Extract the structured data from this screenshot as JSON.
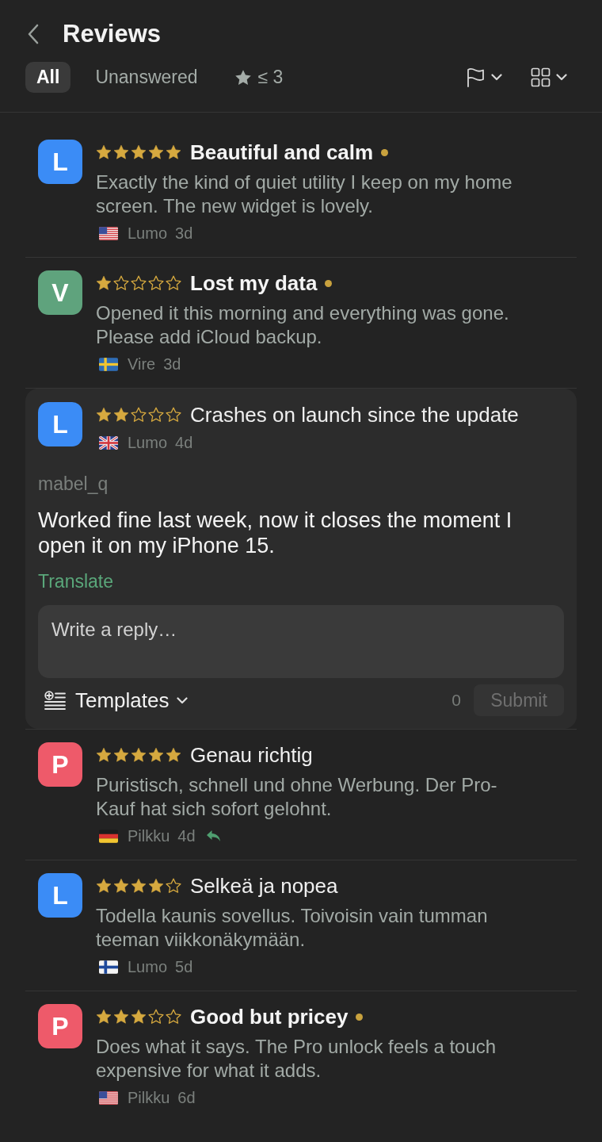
{
  "header": {
    "title": "Reviews"
  },
  "filters": [
    {
      "kind": "text",
      "label": "All",
      "selected": true
    },
    {
      "kind": "text",
      "label": "Unanswered",
      "selected": false
    },
    {
      "kind": "star",
      "label": "≤ 3",
      "selected": false
    }
  ],
  "reviews": [
    {
      "avatar": {
        "letter": "L",
        "color": "#3b8cf6"
      },
      "stars": 5,
      "title": "Beautiful and calm",
      "unread": true,
      "body": "Exactly the kind of quiet utility I keep on my home screen. The new widget is lovely.",
      "flag": {
        "kind": "us"
      },
      "app": "Lumo",
      "age": "3d",
      "replied": false,
      "expanded": false
    },
    {
      "avatar": {
        "letter": "V",
        "color": "#5fa37d"
      },
      "stars": 1,
      "title": "Lost my data",
      "unread": true,
      "body": "Opened it this morning and everything was gone. Please add iCloud backup.",
      "flag": {
        "kind": "se"
      },
      "app": "Vire",
      "age": "3d",
      "replied": false,
      "expanded": false
    },
    {
      "avatar": {
        "letter": "L",
        "color": "#3b8cf6"
      },
      "stars": 2,
      "title": "Crashes on launch since the update",
      "unread": false,
      "flag": {
        "kind": "gb"
      },
      "app": "Lumo",
      "age": "4d",
      "replied": false,
      "expanded": true,
      "author": "mabel_q",
      "body": "Worked fine last week, now it closes the moment I open it on my iPhone 15.",
      "translate": "Translate",
      "reply": {
        "placeholder": "Write a reply…",
        "templates": "Templates",
        "count": "0",
        "submit": "Submit",
        "submit_disabled": true
      }
    },
    {
      "avatar": {
        "letter": "P",
        "color": "#ee5a6a"
      },
      "stars": 5,
      "title": "Genau richtig",
      "unread": false,
      "body": "Puristisch, schnell und ohne Werbung. Der Pro-Kauf hat sich sofort gelohnt.",
      "flag": {
        "kind": "de"
      },
      "app": "Pilkku",
      "age": "4d",
      "replied": true,
      "expanded": false
    },
    {
      "avatar": {
        "letter": "L",
        "color": "#3b8cf6"
      },
      "stars": 4,
      "title": "Selkeä ja nopea",
      "unread": false,
      "body": "Todella kaunis sovellus. Toivoisin vain tumman teeman viikkonäkymään.",
      "flag": {
        "kind": "fi"
      },
      "app": "Lumo",
      "age": "5d",
      "replied": false,
      "expanded": false
    },
    {
      "avatar": {
        "letter": "P",
        "color": "#ee5a6a"
      },
      "stars": 3,
      "title": "Good but pricey",
      "unread": true,
      "body": "Does what it says. The Pro unlock feels a touch expensive for what it adds.",
      "flag": {
        "kind": "us"
      },
      "app": "Pilkku",
      "age": "6d",
      "replied": false,
      "expanded": false
    }
  ]
}
